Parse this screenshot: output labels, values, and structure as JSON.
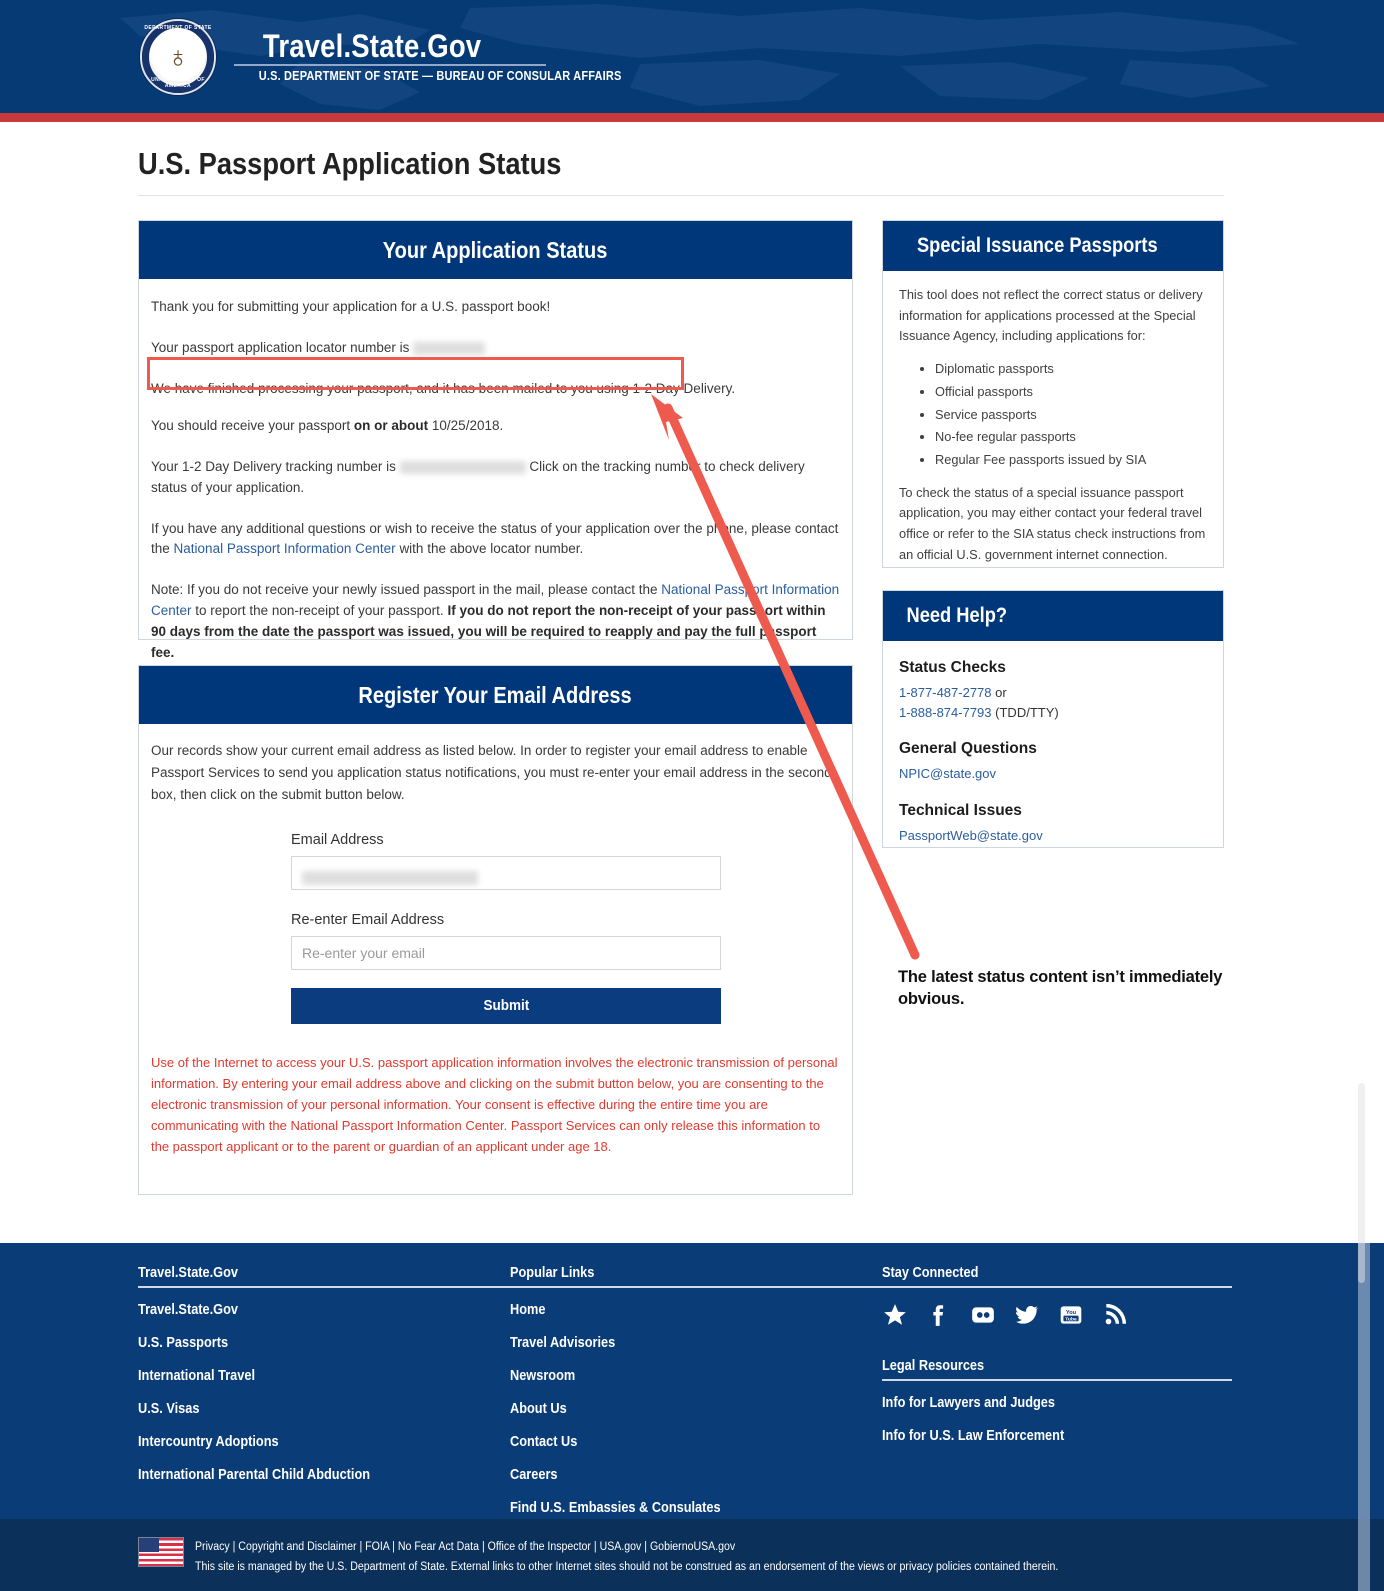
{
  "header": {
    "brand_title": "Travel.State.Gov",
    "brand_subtitle": "U.S. DEPARTMENT OF STATE — BUREAU OF CONSULAR AFFAIRS",
    "seal_top_text": "DEPARTMENT OF STATE",
    "seal_bottom_text": "UNITED STATES OF AMERICA",
    "seal_glyph": "♁"
  },
  "page": {
    "title": "U.S. Passport Application Status"
  },
  "status_panel": {
    "heading": "Your Application Status",
    "thank_you": "Thank you for submitting your application for a U.S. passport book!",
    "locator_prefix": "Your passport application locator number is",
    "locator_value_redacted": "",
    "highlighted_status": "We have finished processing your passport, and it has been mailed to you using 1-2 Day Delivery.",
    "receive_prefix": "You should receive your passport",
    "receive_bold": "on or about",
    "receive_date": "10/25/2018.",
    "tracking_prefix": "Your 1-2 Day Delivery tracking number is",
    "tracking_value_redacted": "",
    "tracking_suffix": "Click on the tracking number to check delivery status of your application.",
    "questions_before_link": "If you have any additional questions or wish to receive the status of your application over the phone, please contact the",
    "questions_link": "National Passport Information Center",
    "questions_after_link": "with the above locator number.",
    "note_before_link": "Note: If you do not receive your newly issued passport in the mail, please contact the",
    "note_link": "National Passport Information Center",
    "note_middle": "to report the non-receipt of your passport.",
    "note_bold": "If you do not report the non-receipt of your passport within 90 days from the date the passport was issued, you will be required to reapply and pay the full passport fee."
  },
  "email_panel": {
    "heading": "Register Your Email Address",
    "intro": "Our records show your current email address as listed below. In order to register your email address to enable Passport Services to send you application status notifications, you must re-enter your email address in the second box, then click on the submit button below.",
    "email_label": "Email Address",
    "email_value_redacted": "",
    "reenter_label": "Re-enter Email Address",
    "reenter_placeholder": "Re-enter your email",
    "submit_label": "Submit",
    "consent": "Use of the Internet to access your U.S. passport application information involves the electronic transmission of personal information. By entering your email address above and clicking on the submit button below, you are consenting to the electronic transmission of your personal information. Your consent is effective during the entire time you are communicating with the National Passport Information Center. Passport Services can only release this information to the passport applicant or to the parent or guardian of an applicant under age 18."
  },
  "sia_panel": {
    "heading": "Special Issuance Passports",
    "intro": "This tool does not reflect the correct status or delivery information for applications processed at the Special Issuance Agency, including applications for:",
    "bullets": [
      "Diplomatic passports",
      "Official passports",
      "Service passports",
      "No-fee regular passports",
      "Regular Fee passports issued by SIA"
    ],
    "outro": "To check the status of a special issuance passport application, you may either contact your federal travel office or refer to the SIA status check instructions from an official U.S. government internet connection."
  },
  "help_panel": {
    "heading": "Need Help?",
    "status_checks_label": "Status Checks",
    "phone_1": "1-877-487-2778",
    "phone_1_suffix": "or",
    "phone_2": "1-888-874-7793",
    "phone_2_suffix": "(TDD/TTY)",
    "general_label": "General Questions",
    "general_email": "NPIC@state.gov",
    "technical_label": "Technical Issues",
    "technical_email": "PassportWeb@state.gov"
  },
  "annotation": {
    "text": "The latest status content isn’t immediately obvious.",
    "highlight_color": "#ee5b4e"
  },
  "footer": {
    "col1_head": "Travel.State.Gov",
    "col1_links": [
      "Travel.State.Gov",
      "U.S. Passports",
      "International Travel",
      "U.S. Visas",
      "Intercountry Adoptions",
      "International Parental Child Abduction"
    ],
    "col2_head": "Popular Links",
    "col2_links": [
      "Home",
      "Travel Advisories",
      "Newsroom",
      "About Us",
      "Contact Us",
      "Careers",
      "Find U.S. Embassies & Consulates"
    ],
    "col3_head": "Stay Connected",
    "social_icons": [
      "star-icon",
      "facebook-icon",
      "flickr-icon",
      "twitter-icon",
      "youtube-icon",
      "rss-icon"
    ],
    "legal_head": "Legal Resources",
    "legal_links": [
      "Info for Lawyers and Judges",
      "Info for U.S. Law Enforcement"
    ],
    "bottom_links": "Privacy | Copyright and Disclaimer | FOIA | No Fear Act Data | Office of the Inspector | USA.gov | GobiernoUSA.gov",
    "bottom_note": "This site is managed by the U.S. Department of State. External links to other Internet sites should not be construed as an endorsement of the views or privacy policies contained therein."
  },
  "colors": {
    "header_blue": "#063a75",
    "header_red_rule": "#c6393c",
    "panel_blue": "#00367a",
    "footer_blue": "#0a3c77",
    "bottombar_blue": "#0b3059",
    "link_blue": "#2a5d9f",
    "consent_red": "#e0392e",
    "annotation_red": "#ee5b4e"
  }
}
